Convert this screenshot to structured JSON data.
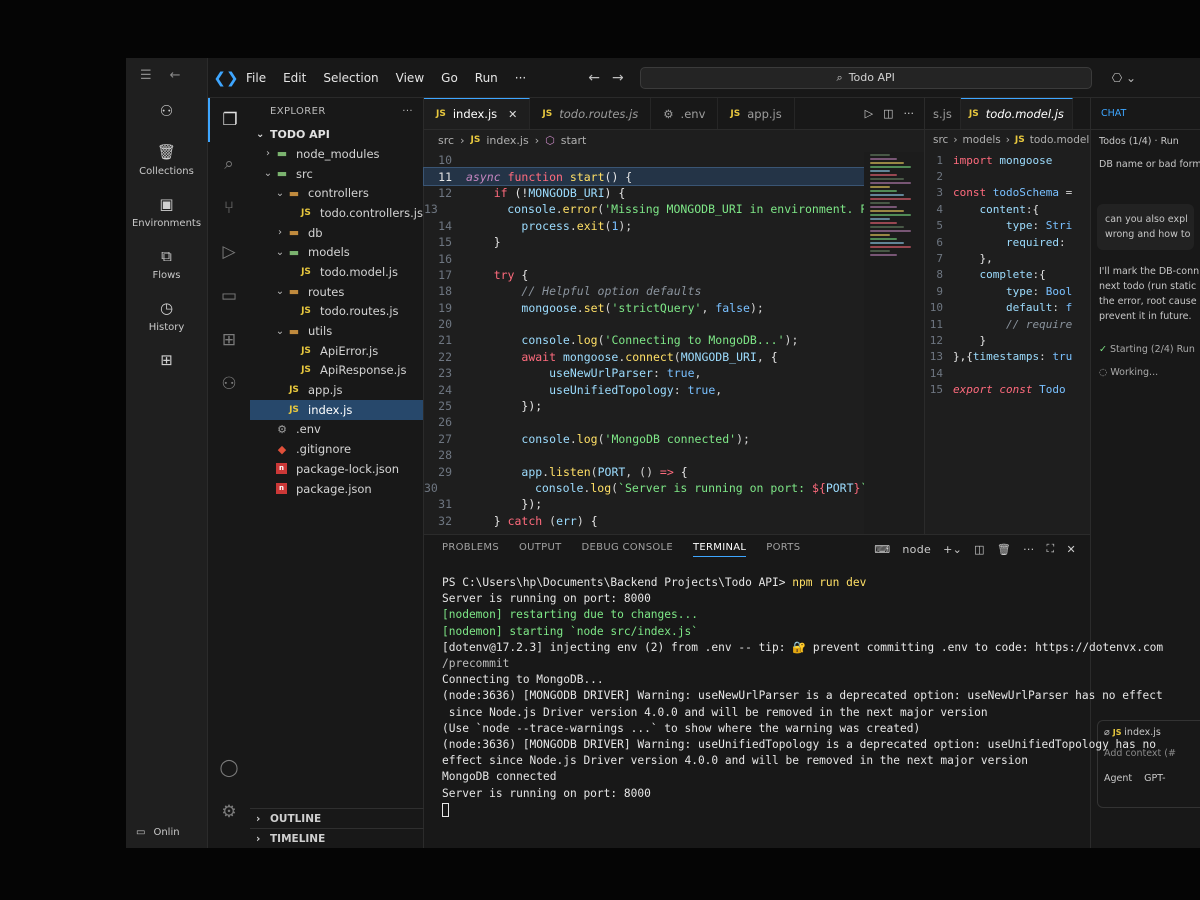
{
  "postman": {
    "items": [
      {
        "icon": "team-icon",
        "label": ""
      },
      {
        "icon": "collections-icon",
        "label": "Collections"
      },
      {
        "icon": "environments-icon",
        "label": "Environments"
      },
      {
        "icon": "flows-icon",
        "label": "Flows"
      },
      {
        "icon": "history-icon",
        "label": "History"
      },
      {
        "icon": "add-workspace-icon",
        "label": ""
      }
    ],
    "status": "Onlin"
  },
  "titlebar": {
    "menu": [
      "File",
      "Edit",
      "Selection",
      "View",
      "Go",
      "Run",
      "···"
    ],
    "search": "Todo API"
  },
  "explorer": {
    "header": "EXPLORER",
    "root": "TODO API",
    "tree": [
      {
        "label": "node_modules",
        "type": "folder-g",
        "indent": 1,
        "chev": "›"
      },
      {
        "label": "src",
        "type": "folder-g",
        "indent": 1,
        "chev": "⌄"
      },
      {
        "label": "controllers",
        "type": "folder",
        "indent": 2,
        "chev": "⌄"
      },
      {
        "label": "todo.controllers.js",
        "type": "js",
        "indent": 3,
        "chev": ""
      },
      {
        "label": "db",
        "type": "folder",
        "indent": 2,
        "chev": "›"
      },
      {
        "label": "models",
        "type": "folder-g",
        "indent": 2,
        "chev": "⌄"
      },
      {
        "label": "todo.model.js",
        "type": "js",
        "indent": 3,
        "chev": ""
      },
      {
        "label": "routes",
        "type": "folder",
        "indent": 2,
        "chev": "⌄"
      },
      {
        "label": "todo.routes.js",
        "type": "js",
        "indent": 3,
        "chev": ""
      },
      {
        "label": "utils",
        "type": "folder",
        "indent": 2,
        "chev": "⌄"
      },
      {
        "label": "ApiError.js",
        "type": "js",
        "indent": 3,
        "chev": ""
      },
      {
        "label": "ApiResponse.js",
        "type": "js",
        "indent": 3,
        "chev": ""
      },
      {
        "label": "app.js",
        "type": "js",
        "indent": 2,
        "chev": ""
      },
      {
        "label": "index.js",
        "type": "js",
        "indent": 2,
        "chev": "",
        "selected": true
      },
      {
        "label": ".env",
        "type": "gear",
        "indent": 1,
        "chev": ""
      },
      {
        "label": ".gitignore",
        "type": "git",
        "indent": 1,
        "chev": ""
      },
      {
        "label": "package-lock.json",
        "type": "npm",
        "indent": 1,
        "chev": ""
      },
      {
        "label": "package.json",
        "type": "npm",
        "indent": 1,
        "chev": ""
      }
    ],
    "outline": "OUTLINE",
    "timeline": "TIMELINE"
  },
  "editor": {
    "tabs": [
      {
        "label": "index.js",
        "icon": "JS",
        "active": true
      },
      {
        "label": "todo.routes.js",
        "icon": "JS",
        "italic": true
      },
      {
        "label": ".env",
        "icon": "gear"
      },
      {
        "label": "app.js",
        "icon": "JS"
      }
    ],
    "breadcrumb": [
      "src",
      "index.js",
      "start"
    ],
    "lines": [
      {
        "n": "10",
        "html": ""
      },
      {
        "n": "11",
        "cur": true,
        "html": "<span class='kc'><i>async</i></span> <span class='k'>function</span> <span class='f'>start</span><span class='p'>() {</span>"
      },
      {
        "n": "12",
        "html": "    <span class='k'>if</span> <span class='p'>(!</span><span class='v'>MONGODB_URI</span><span class='p'>) {</span>"
      },
      {
        "n": "13",
        "html": "        <span class='v'>console</span>.<span class='f'>error</span>(<span class='s'>'Missing MONGODB_URI in environment. Please</span>"
      },
      {
        "n": "14",
        "html": "        <span class='v'>process</span>.<span class='f'>exit</span>(<span class='n'>1</span>);"
      },
      {
        "n": "15",
        "html": "    <span class='p'>}</span>"
      },
      {
        "n": "16",
        "html": ""
      },
      {
        "n": "17",
        "html": "    <span class='k'>try</span> <span class='p'>{</span>"
      },
      {
        "n": "18",
        "html": "        <span class='c'>// Helpful option defaults</span>"
      },
      {
        "n": "19",
        "html": "        <span class='v'>mongoose</span>.<span class='f'>set</span>(<span class='s'>'strictQuery'</span>, <span class='n'>false</span>);"
      },
      {
        "n": "20",
        "html": ""
      },
      {
        "n": "21",
        "html": "        <span class='v'>console</span>.<span class='f'>log</span>(<span class='s'>'Connecting to MongoDB...'</span>);"
      },
      {
        "n": "22",
        "html": "        <span class='k'>await</span> <span class='v'>mongoose</span>.<span class='f'>connect</span>(<span class='v'>MONGODB_URI</span>, <span class='p'>{</span>"
      },
      {
        "n": "23",
        "html": "            <span class='v'>useNewUrlParser</span>: <span class='n'>true</span>,"
      },
      {
        "n": "24",
        "html": "            <span class='v'>useUnifiedTopology</span>: <span class='n'>true</span>,"
      },
      {
        "n": "25",
        "html": "        <span class='p'>});</span>"
      },
      {
        "n": "26",
        "html": ""
      },
      {
        "n": "27",
        "html": "        <span class='v'>console</span>.<span class='f'>log</span>(<span class='s'>'MongoDB connected'</span>);"
      },
      {
        "n": "28",
        "html": ""
      },
      {
        "n": "29",
        "html": "        <span class='v'>app</span>.<span class='f'>listen</span>(<span class='v'>PORT</span>, () <span class='k'>=&gt;</span> <span class='p'>{</span>"
      },
      {
        "n": "30",
        "html": "            <span class='v'>console</span>.<span class='f'>log</span>(<span class='s'>`Server is running on port: </span><span class='k'>${</span><span class='v'>PORT</span><span class='k'>}</span><span class='s'>`</span>);"
      },
      {
        "n": "31",
        "html": "        <span class='p'>});</span>"
      },
      {
        "n": "32",
        "html": "    <span class='p'>}</span> <span class='k'>catch</span> (<span class='v'>err</span>) <span class='p'>{</span>"
      }
    ]
  },
  "editor2": {
    "tab": "todo.model.js",
    "tab_prefix": "s.js",
    "breadcrumb": [
      "src",
      "models",
      "todo.model.js"
    ],
    "lines": [
      {
        "n": "1",
        "html": "<span class='k'>import</span> <span class='v'>mongoose</span>"
      },
      {
        "n": "2",
        "html": ""
      },
      {
        "n": "3",
        "html": "<span class='k'>const</span> <span class='n'>todoSchema</span> ="
      },
      {
        "n": "4",
        "html": "    <span class='v'>content</span>:<span class='p'>{</span>"
      },
      {
        "n": "5",
        "html": "        <span class='v'>type</span>: <span class='n'>Stri</span>"
      },
      {
        "n": "6",
        "html": "        <span class='v'>required</span>:"
      },
      {
        "n": "7",
        "html": "    <span class='p'>},</span>"
      },
      {
        "n": "8",
        "html": "    <span class='v'>complete</span>:<span class='p'>{</span>"
      },
      {
        "n": "9",
        "html": "        <span class='v'>type</span>: <span class='n'>Bool</span>"
      },
      {
        "n": "10",
        "html": "        <span class='v'>default</span>: <span class='n'>f</span>"
      },
      {
        "n": "11",
        "html": "        <span class='c'>// require</span>"
      },
      {
        "n": "12",
        "html": "    <span class='p'>}</span>"
      },
      {
        "n": "13",
        "html": "<span class='p'>},{</span><span class='v'>timestamps</span>: <span class='n'>tru</span>"
      },
      {
        "n": "14",
        "html": ""
      },
      {
        "n": "15",
        "html": "<span class='k'><i>export const</i></span> <span class='n'>Todo</span>"
      }
    ]
  },
  "chat": {
    "header": "CHAT",
    "todos": "Todos (1/4) · Run",
    "note": "DB name or bad forma",
    "user_msg_1": "can you also expl",
    "user_msg_2": "wrong and how to",
    "reply": [
      "I'll mark the DB-conn",
      "next todo (run static",
      "the error, root cause",
      "prevent it in future."
    ],
    "starting": "Starting (2/4) Run",
    "working": "Working...",
    "context_file": "index.js",
    "add_context": "Add context (#",
    "agent": "Agent",
    "model": "GPT-"
  },
  "panel": {
    "tabs": [
      "PROBLEMS",
      "OUTPUT",
      "DEBUG CONSOLE",
      "TERMINAL",
      "PORTS"
    ],
    "active_tab": "TERMINAL",
    "shell": "node",
    "terminal_lines": [
      {
        "cls": "",
        "text": "PS C:\\Users\\hp\\Documents\\Backend Projects\\Todo API> ",
        "cmd": "npm run dev"
      },
      {
        "cls": "",
        "text": "Server is running on port: 8000"
      },
      {
        "cls": "t-green",
        "text": "[nodemon] restarting due to changes..."
      },
      {
        "cls": "t-green",
        "text": "[nodemon] starting `node src/index.js`"
      },
      {
        "cls": "",
        "text": "[dotenv@17.2.3] injecting env (2) from .env -- tip: 🔐 prevent committing .env to code: https://dotenvx.com"
      },
      {
        "cls": "t-dim",
        "text": "/precommit"
      },
      {
        "cls": "",
        "text": "Connecting to MongoDB..."
      },
      {
        "cls": "",
        "text": "(node:3636) [MONGODB DRIVER] Warning: useNewUrlParser is a deprecated option: useNewUrlParser has no effect"
      },
      {
        "cls": "",
        "text": " since Node.js Driver version 4.0.0 and will be removed in the next major version"
      },
      {
        "cls": "",
        "text": "(Use `node --trace-warnings ...` to show where the warning was created)"
      },
      {
        "cls": "",
        "text": "(node:3636) [MONGODB DRIVER] Warning: useUnifiedTopology is a deprecated option: useUnifiedTopology has no"
      },
      {
        "cls": "",
        "text": "effect since Node.js Driver version 4.0.0 and will be removed in the next major version"
      },
      {
        "cls": "",
        "text": "MongoDB connected"
      },
      {
        "cls": "",
        "text": "Server is running on port: 8000"
      }
    ]
  }
}
